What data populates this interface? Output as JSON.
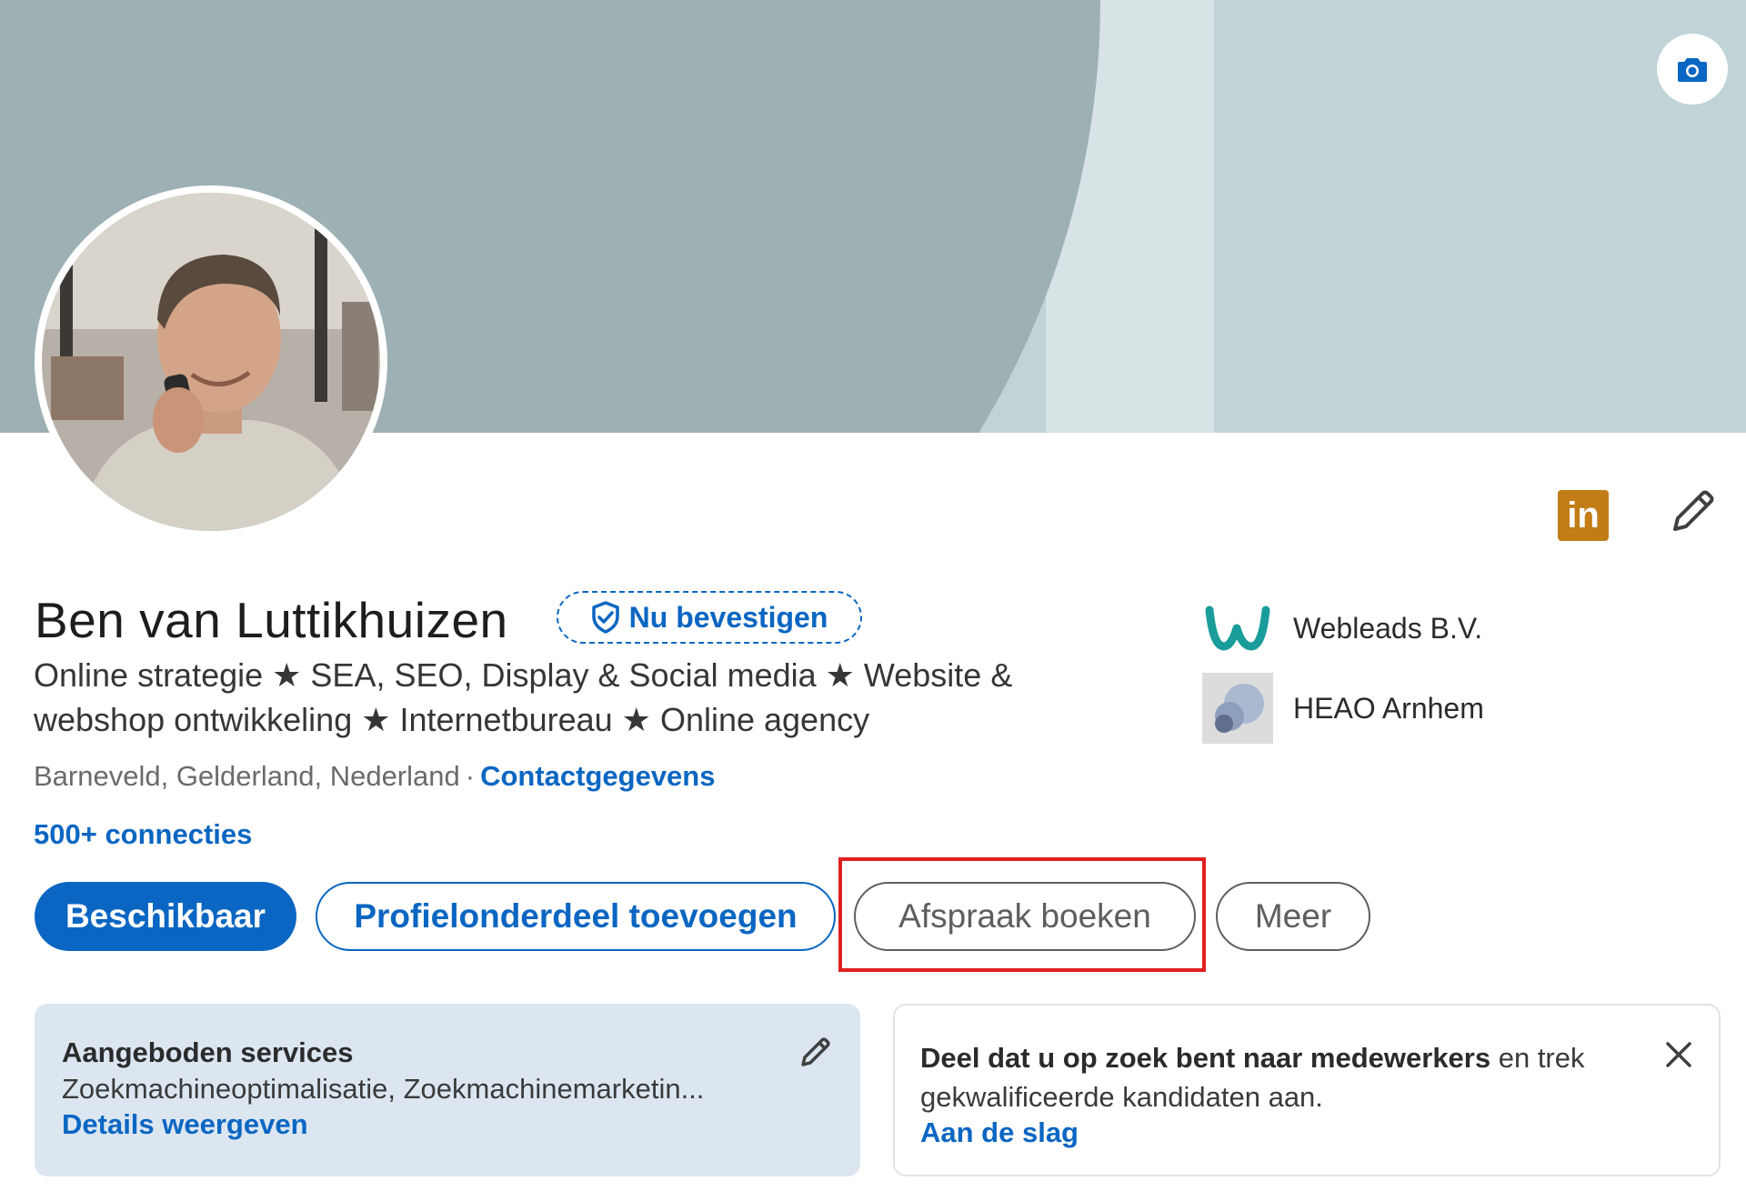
{
  "profile": {
    "name": "Ben van Luttikhuizen",
    "verify_label": "Nu bevestigen",
    "headline": "Online strategie ★ SEA, SEO, Display & Social media ★ Website & webshop ontwikkeling ★ Internetbureau ★ Online agency",
    "location": "Barneveld, Gelderland, Nederland",
    "separator": "·",
    "contact_label": "Contactgegevens",
    "connections": "500+ connecties"
  },
  "organizations": [
    {
      "name": "Webleads B.V.",
      "logo": "webleads-logo"
    },
    {
      "name": "HEAO Arnhem",
      "logo": "heao-logo"
    }
  ],
  "icons": {
    "camera": "camera-icon",
    "linkedin": "linkedin-icon",
    "edit": "pencil-icon",
    "verify": "shield-check-icon",
    "close": "close-icon"
  },
  "actions": {
    "available": "Beschikbaar",
    "add_section": "Profielonderdeel toevoegen",
    "book_meeting": "Afspraak boeken",
    "more": "Meer"
  },
  "cards": {
    "services": {
      "title": "Aangeboden services",
      "text": "Zoekmachineoptimalisatie, Zoekmachinemarketin...",
      "link": "Details weergeven"
    },
    "hiring": {
      "title": "Deel dat u op zoek bent naar medewerkers",
      "text_rest": " en trek",
      "text_line2": "gekwalificeerde kandidaten aan.",
      "link": "Aan de slag"
    }
  },
  "colors": {
    "accent": "#0a66c2",
    "banner": "#9db0b4",
    "highlight": "#e02020",
    "linkedin_badge": "#c37d16"
  }
}
